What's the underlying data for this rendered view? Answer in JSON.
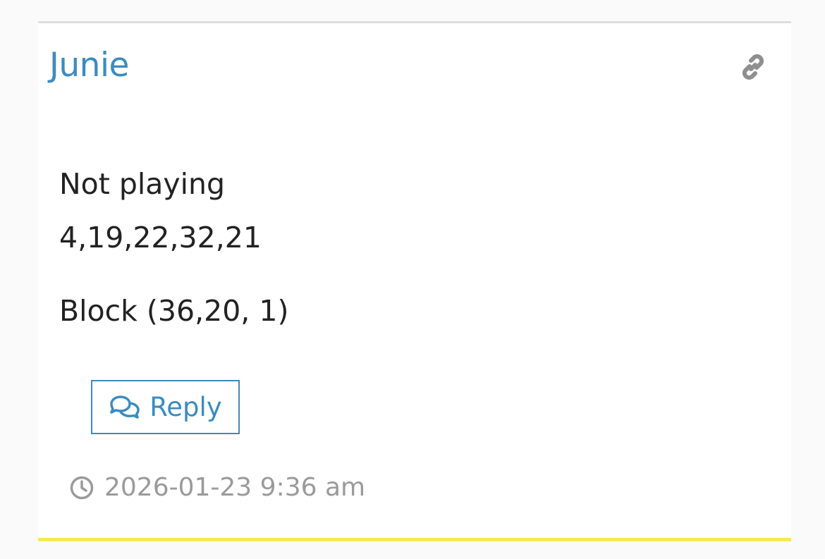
{
  "comment": {
    "author": "Junie",
    "content_lines": [
      "Not playing",
      "4,19,22,32,21",
      "Block (36,20, 1)"
    ],
    "reply_label": "Reply",
    "timestamp": "2026-01-23 9:36 am"
  },
  "icons": {
    "permalink": "link-icon",
    "reply": "chat-bubbles-icon",
    "time": "clock-icon"
  },
  "colors": {
    "accent": "#3b8bc0",
    "text": "#222222",
    "muted": "#9a9a9a",
    "bottom_border": "#f8e855",
    "top_border": "#dedede"
  }
}
